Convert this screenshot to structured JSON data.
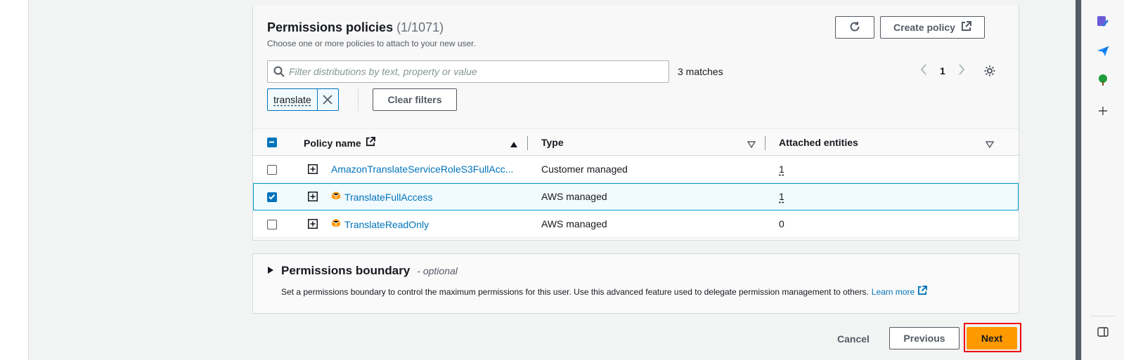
{
  "header": {
    "title": "Permissions policies",
    "count": "(1/1071)",
    "description": "Choose one or more policies to attach to your new user.",
    "refresh_icon": "refresh-icon",
    "create_policy_label": "Create policy"
  },
  "search": {
    "placeholder": "Filter distributions by text, property or value",
    "value": "",
    "matches": "3 matches"
  },
  "pagination": {
    "current_page": "1"
  },
  "filter_token": {
    "label": "translate"
  },
  "clear_filters_label": "Clear filters",
  "table": {
    "columns": [
      "Policy name",
      "Type",
      "Attached entities"
    ],
    "rows": [
      {
        "name": "AmazonTranslateServiceRoleS3FullAcc...",
        "type": "Customer managed",
        "entities": "1",
        "checked": false,
        "aws_icon": false
      },
      {
        "name": "TranslateFullAccess",
        "type": "AWS managed",
        "entities": "1",
        "checked": true,
        "aws_icon": true
      },
      {
        "name": "TranslateReadOnly",
        "type": "AWS managed",
        "entities": "0",
        "checked": false,
        "aws_icon": true
      }
    ]
  },
  "boundary": {
    "title": "Permissions boundary",
    "optional": "- optional",
    "description": "Set a permissions boundary to control the maximum permissions for this user. Use this advanced feature used to delegate permission management to others.",
    "learn_more": "Learn more"
  },
  "footer": {
    "cancel_label": "Cancel",
    "previous_label": "Previous",
    "next_label": "Next"
  },
  "colors": {
    "link": "#0073bb",
    "primary_button": "#ff9900",
    "highlight": "#ee0000",
    "aws_icon": "#ff9900"
  }
}
